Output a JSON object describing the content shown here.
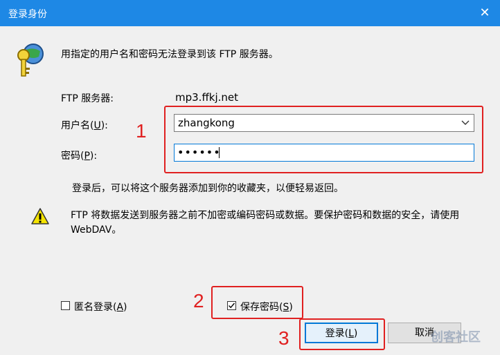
{
  "window": {
    "title": "登录身份",
    "close_glyph": "✕"
  },
  "message": "用指定的用户名和密码无法登录到该 FTP 服务器。",
  "ftp_server": {
    "label": "FTP 服务器:",
    "value": "mp3.ffkj.net"
  },
  "username": {
    "label_prefix": "用户名(",
    "label_key": "U",
    "label_suffix": "):",
    "value": "zhangkong"
  },
  "password": {
    "label_prefix": "密码(",
    "label_key": "P",
    "label_suffix": "):",
    "masked_value": "••••••"
  },
  "info_text": "登录后，可以将这个服务器添加到你的收藏夹，以便轻易返回。",
  "warning_line1": "FTP 将数据发送到服务器之前不加密或编码密码或数据。要保护密码和数据的安全，请使用",
  "warning_line2": "WebDAV。",
  "anonymous": {
    "label_prefix": "匿名登录(",
    "label_key": "A",
    "label_suffix": ")",
    "checked": false
  },
  "save_password": {
    "label_prefix": "保存密码(",
    "label_key": "S",
    "label_suffix": ")",
    "checked": true
  },
  "buttons": {
    "login_prefix": "登录(",
    "login_key": "L",
    "login_suffix": ")",
    "cancel": "取消"
  },
  "annotations": [
    "1",
    "2",
    "3"
  ],
  "watermark": "创客社区",
  "colors": {
    "titlebar": "#1e88e5",
    "highlight": "#e02020",
    "focus": "#0078d7"
  }
}
